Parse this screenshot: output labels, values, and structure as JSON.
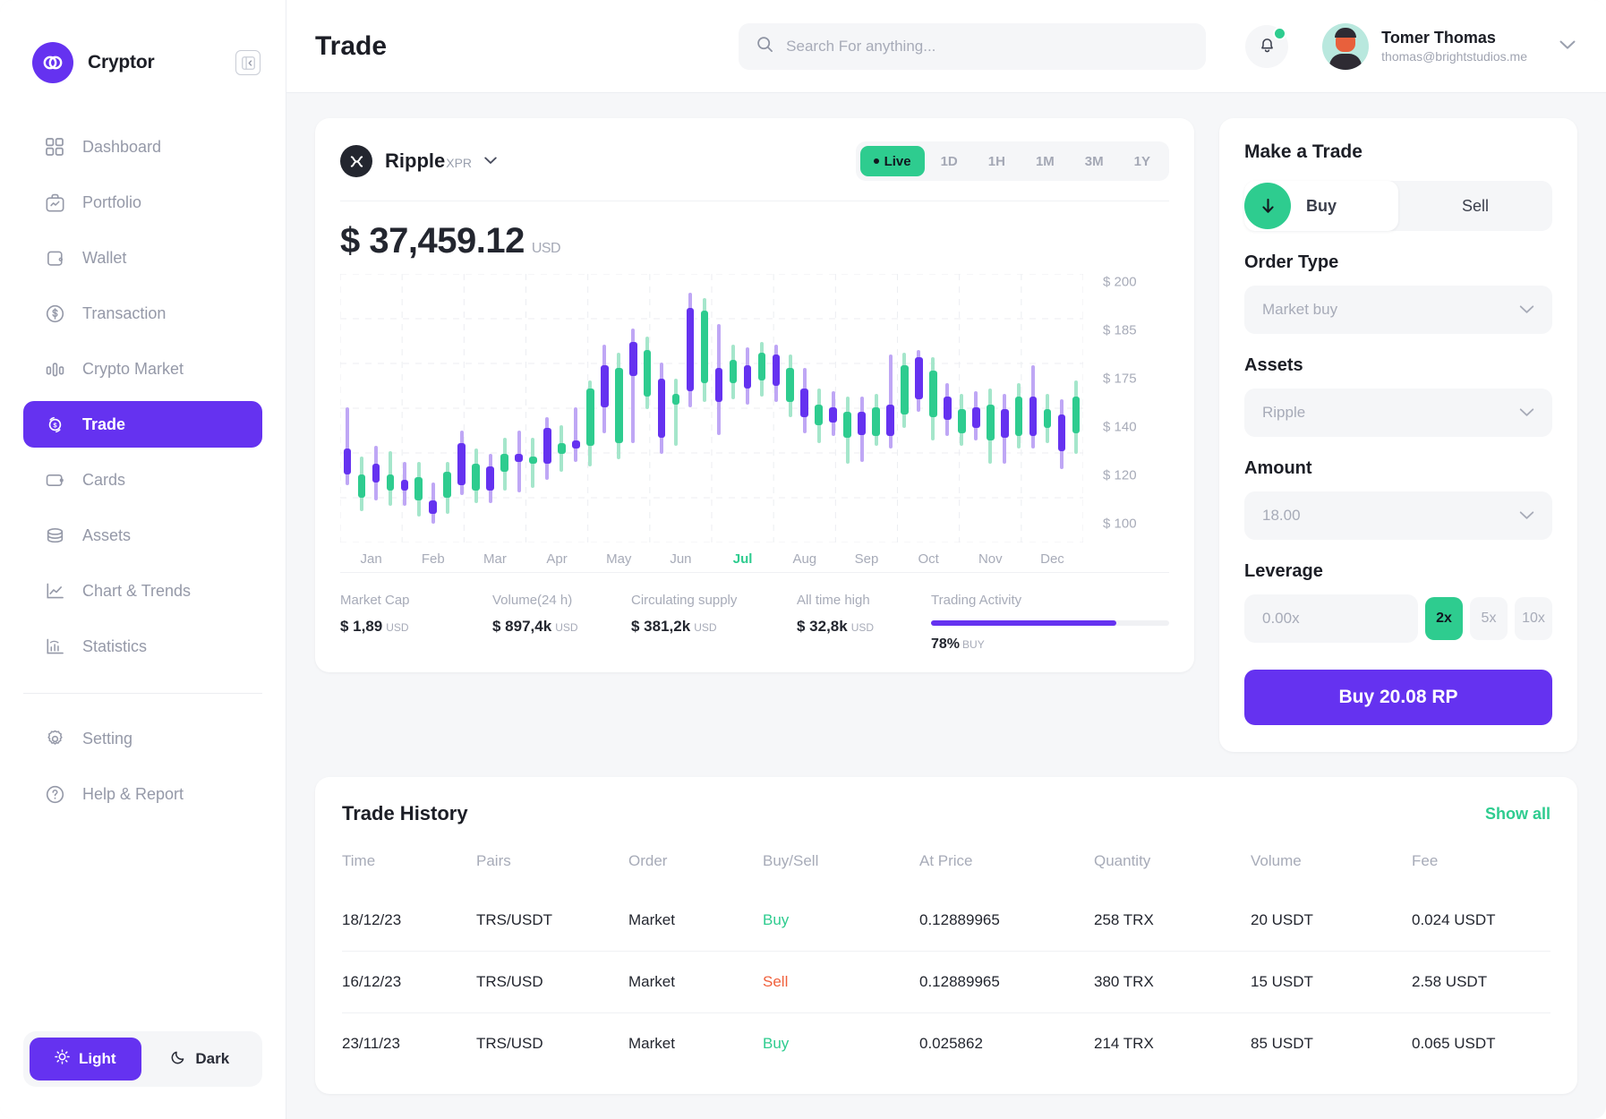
{
  "sidebar": {
    "brand": "Cryptor",
    "collapse_icon": "panel-collapse-icon",
    "items": [
      {
        "label": "Dashboard",
        "icon": "grid-icon",
        "active": false
      },
      {
        "label": "Portfolio",
        "icon": "briefcase-icon",
        "active": false
      },
      {
        "label": "Wallet",
        "icon": "wallet-icon",
        "active": false
      },
      {
        "label": "Transaction",
        "icon": "dollar-circle-icon",
        "active": false
      },
      {
        "label": "Crypto Market",
        "icon": "bar-chart-icon",
        "active": false
      },
      {
        "label": "Trade",
        "icon": "trade-icon",
        "active": true
      },
      {
        "label": "Cards",
        "icon": "card-icon",
        "active": false
      },
      {
        "label": "Assets",
        "icon": "coins-icon",
        "active": false
      },
      {
        "label": "Chart & Trends",
        "icon": "line-chart-icon",
        "active": false
      },
      {
        "label": "Statistics",
        "icon": "statistics-icon",
        "active": false
      }
    ],
    "bottom_items": [
      {
        "label": "Setting",
        "icon": "gear-icon"
      },
      {
        "label": "Help & Report",
        "icon": "question-circle-icon"
      }
    ],
    "theme": {
      "light": "Light",
      "dark": "Dark",
      "active": "Light"
    }
  },
  "header": {
    "title": "Trade",
    "search_placeholder": "Search For anything...",
    "user_name": "Tomer Thomas",
    "user_email": "thomas@brightstudios.me"
  },
  "chart_panel": {
    "coin_name": "Ripple",
    "coin_symbol": "XPR",
    "price": "$ 37,459.12",
    "price_currency": "USD",
    "ranges": [
      "Live",
      "1D",
      "1H",
      "1M",
      "3M",
      "1Y"
    ],
    "active_range": "Live",
    "stats": [
      {
        "label": "Market Cap",
        "value": "$ 1,89",
        "unit": "USD"
      },
      {
        "label": "Volume(24 h)",
        "value": "$ 897,4k",
        "unit": "USD"
      },
      {
        "label": "Circulating supply",
        "value": "$ 381,2k",
        "unit": "USD"
      },
      {
        "label": "All time high",
        "value": "$ 32,8k",
        "unit": "USD"
      }
    ],
    "activity": {
      "label": "Trading Activity",
      "percent": 78,
      "percent_text": "78%",
      "side": "BUY"
    }
  },
  "chart_data": {
    "type": "candlestick",
    "title": "Ripple XPR price",
    "xlabel": "",
    "ylabel": "",
    "ytick_labels": [
      "$ 200",
      "$ 185",
      "$ 175",
      "$ 140",
      "$ 120",
      "$ 100"
    ],
    "ytick_positions": [
      0.03,
      0.21,
      0.39,
      0.57,
      0.75,
      0.93
    ],
    "xtick_labels": [
      "Jan",
      "Feb",
      "Mar",
      "Apr",
      "May",
      "Jun",
      "Jul",
      "Aug",
      "Sep",
      "Oct",
      "Nov",
      "Dec"
    ],
    "active_xtick": "Jul",
    "grid": true,
    "up_color": "#2ecc8f",
    "down_color": "#6532f0",
    "candles": [
      {
        "open": 132,
        "close": 122,
        "high": 148,
        "low": 118,
        "dir": "down"
      },
      {
        "open": 122,
        "close": 113,
        "high": 129,
        "low": 108,
        "dir": "up"
      },
      {
        "open": 126,
        "close": 119,
        "high": 133,
        "low": 112,
        "dir": "down"
      },
      {
        "open": 122,
        "close": 116,
        "high": 131,
        "low": 110,
        "dir": "up"
      },
      {
        "open": 120,
        "close": 116,
        "high": 127,
        "low": 110,
        "dir": "down"
      },
      {
        "open": 121,
        "close": 112,
        "high": 127,
        "low": 106,
        "dir": "up"
      },
      {
        "open": 112,
        "close": 107,
        "high": 119,
        "low": 103,
        "dir": "down"
      },
      {
        "open": 123,
        "close": 113,
        "high": 127,
        "low": 107,
        "dir": "up"
      },
      {
        "open": 134,
        "close": 118,
        "high": 139,
        "low": 114,
        "dir": "down"
      },
      {
        "open": 126,
        "close": 116,
        "high": 132,
        "low": 111,
        "dir": "up"
      },
      {
        "open": 125,
        "close": 116,
        "high": 130,
        "low": 111,
        "dir": "down"
      },
      {
        "open": 130,
        "close": 123,
        "high": 136,
        "low": 116,
        "dir": "up"
      },
      {
        "open": 130,
        "close": 127,
        "high": 139,
        "low": 115,
        "dir": "down"
      },
      {
        "open": 129,
        "close": 126,
        "high": 136,
        "low": 117,
        "dir": "up"
      },
      {
        "open": 140,
        "close": 126,
        "high": 144,
        "low": 120,
        "dir": "down"
      },
      {
        "open": 134,
        "close": 130,
        "high": 141,
        "low": 123,
        "dir": "up"
      },
      {
        "open": 135,
        "close": 132,
        "high": 148,
        "low": 127,
        "dir": "down"
      },
      {
        "open": 155,
        "close": 133,
        "high": 158,
        "low": 125,
        "dir": "up"
      },
      {
        "open": 164,
        "close": 148,
        "high": 172,
        "low": 138,
        "dir": "down"
      },
      {
        "open": 163,
        "close": 134,
        "high": 169,
        "low": 128,
        "dir": "up"
      },
      {
        "open": 173,
        "close": 160,
        "high": 178,
        "low": 134,
        "dir": "down"
      },
      {
        "open": 170,
        "close": 152,
        "high": 175,
        "low": 147,
        "dir": "up"
      },
      {
        "open": 159,
        "close": 136,
        "high": 165,
        "low": 130,
        "dir": "down"
      },
      {
        "open": 153,
        "close": 149,
        "high": 159,
        "low": 133,
        "dir": "up"
      },
      {
        "open": 186,
        "close": 154,
        "high": 192,
        "low": 148,
        "dir": "down"
      },
      {
        "open": 185,
        "close": 157,
        "high": 190,
        "low": 150,
        "dir": "up"
      },
      {
        "open": 163,
        "close": 150,
        "high": 180,
        "low": 137,
        "dir": "down"
      },
      {
        "open": 166,
        "close": 157,
        "high": 172,
        "low": 151,
        "dir": "up"
      },
      {
        "open": 164,
        "close": 155,
        "high": 171,
        "low": 149,
        "dir": "down"
      },
      {
        "open": 169,
        "close": 158,
        "high": 173,
        "low": 152,
        "dir": "up"
      },
      {
        "open": 168,
        "close": 156,
        "high": 172,
        "low": 150,
        "dir": "down"
      },
      {
        "open": 163,
        "close": 150,
        "high": 168,
        "low": 144,
        "dir": "up"
      },
      {
        "open": 155,
        "close": 144,
        "high": 163,
        "low": 138,
        "dir": "down"
      },
      {
        "open": 149,
        "close": 141,
        "high": 155,
        "low": 134,
        "dir": "up"
      },
      {
        "open": 148,
        "close": 142,
        "high": 154,
        "low": 137,
        "dir": "down"
      },
      {
        "open": 146,
        "close": 136,
        "high": 152,
        "low": 126,
        "dir": "up"
      },
      {
        "open": 146,
        "close": 137,
        "high": 152,
        "low": 127,
        "dir": "down"
      },
      {
        "open": 148,
        "close": 137,
        "high": 153,
        "low": 133,
        "dir": "up"
      },
      {
        "open": 149,
        "close": 137,
        "high": 168,
        "low": 132,
        "dir": "down"
      },
      {
        "open": 164,
        "close": 145,
        "high": 169,
        "low": 140,
        "dir": "up"
      },
      {
        "open": 167,
        "close": 151,
        "high": 170,
        "low": 146,
        "dir": "down"
      },
      {
        "open": 162,
        "close": 144,
        "high": 167,
        "low": 135,
        "dir": "up"
      },
      {
        "open": 152,
        "close": 143,
        "high": 157,
        "low": 137,
        "dir": "down"
      },
      {
        "open": 147,
        "close": 138,
        "high": 153,
        "low": 133,
        "dir": "up"
      },
      {
        "open": 148,
        "close": 140,
        "high": 154,
        "low": 135,
        "dir": "down"
      },
      {
        "open": 149,
        "close": 135,
        "high": 155,
        "low": 126,
        "dir": "up"
      },
      {
        "open": 147,
        "close": 136,
        "high": 153,
        "low": 126,
        "dir": "down"
      },
      {
        "open": 152,
        "close": 137,
        "high": 157,
        "low": 132,
        "dir": "up"
      },
      {
        "open": 152,
        "close": 137,
        "high": 164,
        "low": 132,
        "dir": "down"
      },
      {
        "open": 147,
        "close": 140,
        "high": 153,
        "low": 134,
        "dir": "up"
      },
      {
        "open": 145,
        "close": 131,
        "high": 151,
        "low": 124,
        "dir": "down"
      },
      {
        "open": 152,
        "close": 138,
        "high": 158,
        "low": 130,
        "dir": "up"
      }
    ]
  },
  "trade_panel": {
    "title": "Make a Trade",
    "buy_label": "Buy",
    "sell_label": "Sell",
    "selected_side": "Buy",
    "order_type_label": "Order Type",
    "order_type_value": "Market buy",
    "assets_label": "Assets",
    "assets_value": "Ripple",
    "amount_label": "Amount",
    "amount_value": "18.00",
    "leverage_label": "Leverage",
    "leverage_value": "0.00x",
    "leverage_options": [
      "2x",
      "5x",
      "10x"
    ],
    "leverage_selected": "2x",
    "submit_label": "Buy 20.08 RP"
  },
  "history": {
    "title": "Trade History",
    "show_all": "Show all",
    "columns": [
      "Time",
      "Pairs",
      "Order",
      "Buy/Sell",
      "At Price",
      "Quantity",
      "Volume",
      "Fee"
    ],
    "rows": [
      {
        "time": "18/12/23",
        "pairs": "TRS/USDT",
        "order": "Market",
        "side": "Buy",
        "side_type": "buy",
        "at_price": "0.12889965",
        "quantity": "258 TRX",
        "volume": "20 USDT",
        "fee": "0.024 USDT"
      },
      {
        "time": "16/12/23",
        "pairs": "TRS/USD",
        "order": "Market",
        "side": "Sell",
        "side_type": "sell",
        "at_price": "0.12889965",
        "quantity": "380 TRX",
        "volume": "15 USDT",
        "fee": "2.58 USDT"
      },
      {
        "time": "23/11/23",
        "pairs": "TRS/USD",
        "order": "Market",
        "side": "Buy",
        "side_type": "buy",
        "at_price": "0.025862",
        "quantity": "214 TRX",
        "volume": "85 USDT",
        "fee": "0.065 USDT"
      }
    ]
  },
  "colors": {
    "accent": "#6532f0",
    "green": "#2ecc8f",
    "red": "#f0603c",
    "muted": "#a7abb8",
    "dark": "#23262f"
  }
}
